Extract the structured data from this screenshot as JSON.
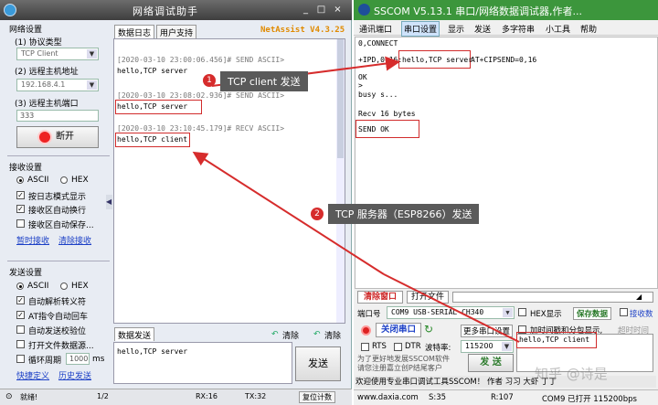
{
  "netassist": {
    "title": "网络调试助手",
    "window_controls": [
      "_",
      "□",
      "×"
    ],
    "settings": {
      "group_title": "网络设置",
      "protocol_label": "(1) 协议类型",
      "protocol_value": "TCP Client",
      "host_label": "(2) 远程主机地址",
      "host_value": "192.168.4.1",
      "port_label": "(3) 远程主机端口",
      "port_value": "333",
      "disconnect_label": "断开"
    },
    "receive": {
      "group_title": "接收设置",
      "ascii_label": "ASCII",
      "hex_label": "HEX",
      "options": [
        "按日志模式显示",
        "接收区自动换行",
        "接收区自动保存..."
      ],
      "options_checked": [
        true,
        true,
        false
      ],
      "link_save": "暂时接收",
      "link_clear": "清除接收"
    },
    "send": {
      "group_title": "发送设置",
      "ascii_label": "ASCII",
      "hex_label": "HEX",
      "options": [
        "自动解析转义符",
        "AT指令自动回车",
        "自动发送校验位",
        "打开文件数据源...",
        "循环周期"
      ],
      "options_checked": [
        true,
        true,
        false,
        false,
        false
      ],
      "period_value": "1000",
      "period_unit": "ms",
      "link_shortcut": "快捷定义",
      "link_history": "历史发送"
    },
    "tabs": [
      "数据日志",
      "用户支持"
    ],
    "brand": "NetAssist V4.3.25",
    "log": [
      {
        "meta": "[2020-03-10 23:00:06.456]# SEND ASCII>",
        "data": "hello,TCP server"
      },
      {
        "meta": "[2020-03-10 23:08:02.936]# SEND ASCII>",
        "data": "hello,TCP server"
      },
      {
        "meta": "[2020-03-10 23:10:45.179]# RECV ASCII>",
        "data": "hello,TCP client"
      }
    ],
    "send_tab": "数据发送",
    "clear_label_1": "清除",
    "clear_label_2": "清除",
    "send_text": "hello,TCP server",
    "send_button": "发送",
    "status": {
      "ready": "就绪!",
      "count": "1/2",
      "rx": "RX:16",
      "tx": "TX:32",
      "reset": "复位计数"
    }
  },
  "sscom": {
    "title": "SSCOM V5.13.1 串口/网络数据调试器,作者...",
    "menu": [
      "通讯端口",
      "串口设置",
      "显示",
      "发送",
      "多字符串",
      "小工具",
      "帮助"
    ],
    "output": [
      "0,CONNECT",
      "+IPD,0,16:",
      "hello,TCP server",
      "AT+CIPSEND=0,16",
      "OK",
      ">",
      "busy s...",
      "Recv 16 bytes",
      "SEND OK"
    ],
    "clear_window": "清除窗口",
    "open_file": "打开文件",
    "port_label": "端口号",
    "port_value": "COM9 USB-SERIAL CH340",
    "hex_display": "HEX显示",
    "save_data": "保存数据",
    "recv_data": "接收数",
    "close_port": "关闭串口",
    "more_settings": "更多串口设置",
    "timestamp_label": "加时间戳和分包显示,",
    "timeout_label": "超时时间",
    "rts": "RTS",
    "dtr": "DTR",
    "baud_label": "波特率:",
    "baud_value": "115200",
    "send_text": "hello,TCP client",
    "send_button": "发 送",
    "promo_1": "为了更好地发展SSCOM软件",
    "promo_2": "请您注册嘉立创P结尾客户",
    "ticker": "欢迎使用专业串口调试工具SSCOM！ 作者  习习 大虾 丁丁",
    "status": {
      "site": "www.daxia.com",
      "s": "S:35",
      "r": "R:107",
      "com": "COM9 已打开  115200bps"
    }
  },
  "annotations": {
    "callout_1_num": "1",
    "callout_1": "TCP client 发送",
    "callout_2_num": "2",
    "callout_2": "TCP 服务器（ESP8266）发送"
  },
  "watermark": "知乎 @诗是",
  "colors": {
    "annotation_red": "#d62c2c",
    "sscom_title_green": "#3c963c",
    "netassist_brand": "#e08a00"
  }
}
